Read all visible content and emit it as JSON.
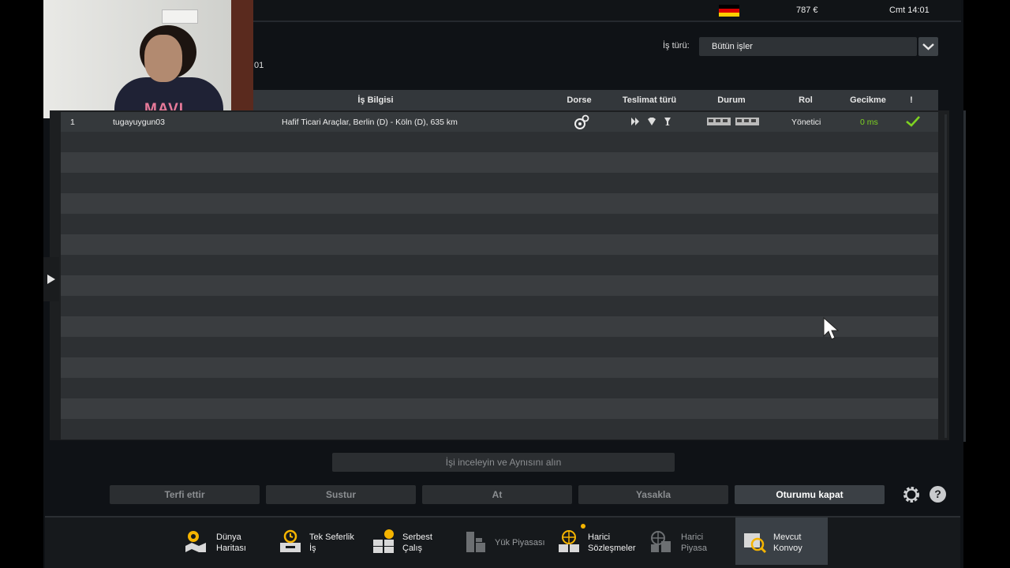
{
  "statusbar": {
    "money": "787 €",
    "clock": "Cmt 14:01",
    "flag_colors": [
      "#000000",
      "#dd0000",
      "#ffce00"
    ]
  },
  "webcam": {
    "shirt_text": "MAVI"
  },
  "partial_label": "01",
  "filter": {
    "label": "İş türü:",
    "value": "Bütün işler"
  },
  "table": {
    "headers": {
      "job_info": "İş Bilgisi",
      "trailer": "Dorse",
      "delivery": "Teslimat türü",
      "status": "Durum",
      "role": "Rol",
      "delay": "Gecikme",
      "alert": "!"
    },
    "rows": [
      {
        "index": "1",
        "player": "tugayuygun03",
        "job": "Hafif Ticari Araçlar, Berlin (D) - Köln (D), 635 km",
        "role": "Yönetici",
        "delay": "0 ms"
      }
    ]
  },
  "actions": {
    "inspect": "İşi inceleyin ve Aynısını alın",
    "promote": "Terfi ettir",
    "mute": "Sustur",
    "kick": "At",
    "ban": "Yasakla",
    "logout": "Oturumu kapat",
    "help": "?"
  },
  "nav": {
    "world_map": [
      "Dünya",
      "Haritası"
    ],
    "single_job": [
      "Tek Seferlik",
      "İş"
    ],
    "freelance": [
      "Serbest",
      "Çalış"
    ],
    "cargo_market": "Yük Piyasası",
    "external_contracts": [
      "Harici",
      "Sözleşmeler"
    ],
    "external_market": [
      "Harici",
      "Piyasa"
    ],
    "current_convoy": [
      "Mevcut",
      "Konvoy"
    ]
  },
  "colors": {
    "accent_green": "#7ed321",
    "accent_yellow": "#f5b400",
    "panel": "#2b2e31"
  }
}
